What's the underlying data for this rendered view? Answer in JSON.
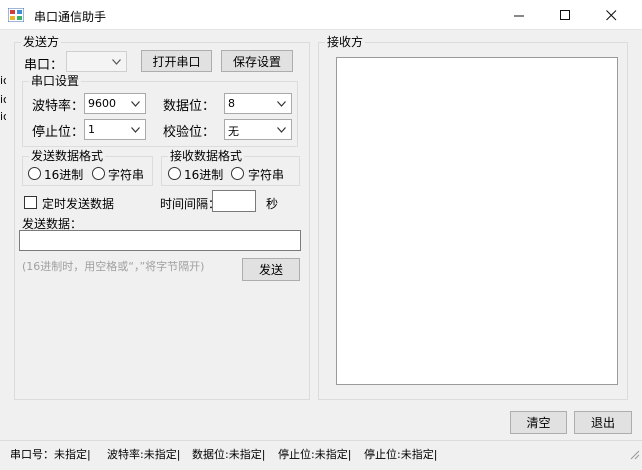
{
  "window": {
    "title": "串口通信助手",
    "controls": {
      "minimize": "—",
      "maximize": "☐",
      "close": "✕"
    }
  },
  "send_panel": {
    "legend": "发送方",
    "port_label": "串口：",
    "port_value": "",
    "open_port_label": "打开串口",
    "save_settings_label": "保存设置",
    "serial_settings": {
      "legend": "串口设置",
      "baud_label": "波特率：",
      "baud_value": "9600",
      "databits_label": "数据位：",
      "databits_value": "8",
      "stopbits_label": "停止位：",
      "stopbits_value": "1",
      "parity_label": "校验位：",
      "parity_value": "无"
    },
    "send_format": {
      "legend": "发送数据格式",
      "hex": "16进制",
      "string": "字符串"
    },
    "recv_format": {
      "legend": "接收数据格式",
      "hex": "16进制",
      "string": "字符串"
    },
    "timed_send_label": "定时发送数据",
    "interval_label": "时间间隔：",
    "interval_value": "",
    "interval_unit": "秒",
    "send_data_label": "发送数据：",
    "send_data_value": "",
    "hint": "(16进制时，用空格或“，”将字节隔开)",
    "send_button": "发送"
  },
  "receive_panel": {
    "legend": "接收方",
    "content": ""
  },
  "actions": {
    "clear": "清空",
    "exit": "退出"
  },
  "statusbar": {
    "items": [
      "串口号：未指定|",
      "波特率:未指定|",
      "数据位:未指定|",
      "停止位:未指定|",
      "停止位:未指定|"
    ]
  },
  "left_edge_fragments": [
    "ic",
    "ic",
    "ic"
  ]
}
